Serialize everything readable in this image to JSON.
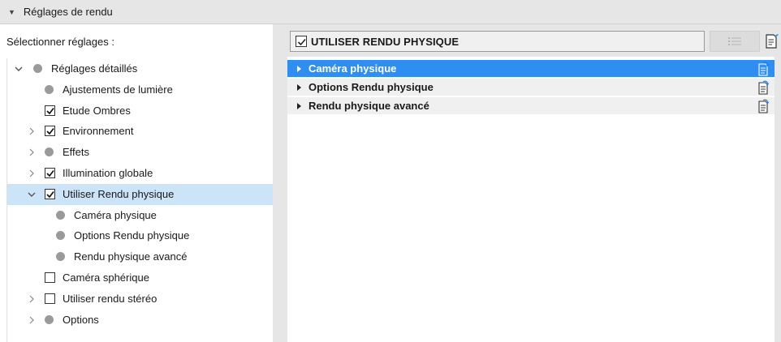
{
  "header": {
    "title": "Réglages de rendu",
    "caret_icon": "triangle-down-icon"
  },
  "left": {
    "label": "Sélectionner réglages :",
    "tree": [
      {
        "label": "Réglages détaillés",
        "level": 0,
        "expander": "expanded",
        "marker": "dot"
      },
      {
        "label": "Ajustements de lumière",
        "level": 1,
        "expander": "none",
        "marker": "dot"
      },
      {
        "label": "Etude Ombres",
        "level": 1,
        "expander": "none",
        "marker": "checked"
      },
      {
        "label": "Environnement",
        "level": 1,
        "expander": "collapsed",
        "marker": "checked"
      },
      {
        "label": "Effets",
        "level": 1,
        "expander": "collapsed",
        "marker": "dot"
      },
      {
        "label": "Illumination globale",
        "level": 1,
        "expander": "collapsed",
        "marker": "checked"
      },
      {
        "label": "Utiliser Rendu physique",
        "level": 1,
        "expander": "expanded",
        "marker": "checked",
        "selected": true
      },
      {
        "label": "Caméra physique",
        "level": 2,
        "expander": "none",
        "marker": "dot"
      },
      {
        "label": "Options Rendu physique",
        "level": 2,
        "expander": "none",
        "marker": "dot"
      },
      {
        "label": "Rendu physique avancé",
        "level": 2,
        "expander": "none",
        "marker": "dot"
      },
      {
        "label": "Caméra sphérique",
        "level": 1,
        "expander": "none",
        "marker": "unchecked"
      },
      {
        "label": "Utiliser rendu stéréo",
        "level": 1,
        "expander": "collapsed",
        "marker": "unchecked"
      },
      {
        "label": "Options",
        "level": 1,
        "expander": "collapsed",
        "marker": "dot"
      }
    ]
  },
  "right": {
    "mode_label": "UTILISER RENDU PHYSIQUE",
    "mode_checked": true,
    "list_button_icon": "list-view-icon",
    "edit_button_icon": "edit-document-icon",
    "rows": [
      {
        "label": "Caméra physique",
        "active": true
      },
      {
        "label": "Options Rendu physique",
        "active": false
      },
      {
        "label": "Rendu physique avancé",
        "active": false
      }
    ],
    "row_icon": "document-settings-icon"
  },
  "colors": {
    "accent": "#2f8ef2",
    "selection": "#cce4f7",
    "chrome": "#e6e6e6"
  }
}
